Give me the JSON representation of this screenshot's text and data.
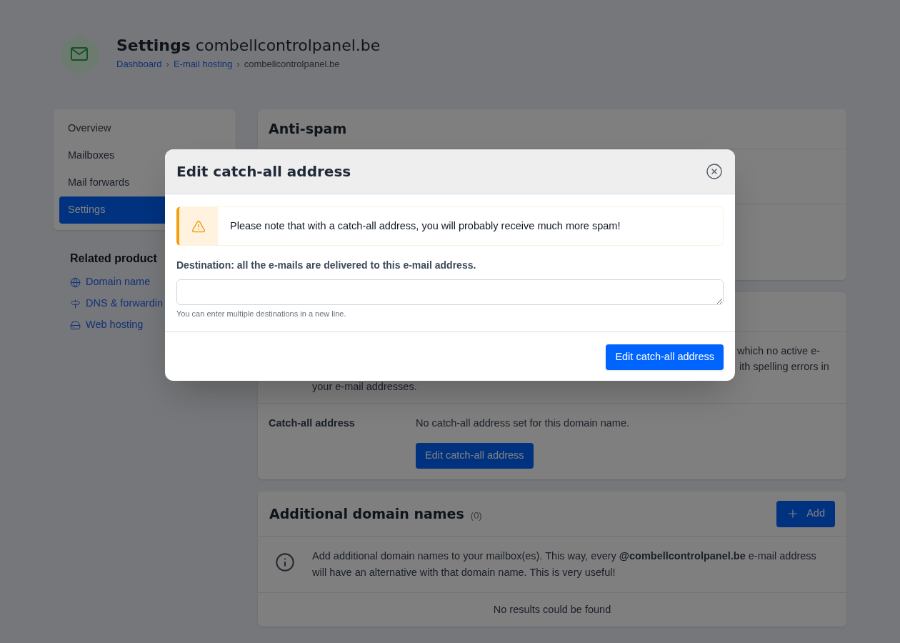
{
  "header": {
    "title": "**Settings** combellcontrolpanel.be",
    "breadcrumb": [
      {
        "kind": "link",
        "text": "Dashboard"
      },
      {
        "kind": "separator",
        "text": "›"
      },
      {
        "kind": "link",
        "text": "E-mail hosting"
      },
      {
        "kind": "separator",
        "text": "›"
      },
      {
        "kind": "current",
        "text": "combellcontrolpanel.be"
      }
    ]
  },
  "sidebar": {
    "nav": [
      {
        "label": "Overview",
        "selected": false
      },
      {
        "label": "Mailboxes",
        "selected": false
      },
      {
        "label": "Mail forwards",
        "selected": false
      },
      {
        "label": "Settings",
        "selected": true
      }
    ],
    "related": {
      "title": "Related product",
      "links": [
        "Domain name",
        "DNS & forwardin",
        "Web hosting"
      ]
    }
  },
  "anti_spam": {
    "title": "Anti-spam"
  },
  "catch_all": {
    "description_fragments": [
      "which no active e-",
      "ith spelling errors in",
      "your e-mail addresses."
    ],
    "label": "Catch-all address",
    "value": "No catch-all address set for this domain name.",
    "button": "Edit catch-all address"
  },
  "additional_domains": {
    "title": "Additional domain names",
    "count": "(0)",
    "add_button": "Add",
    "info": "Add additional domain names to your mailbox(es). This way, every **@combellcontrolpanel.be** e-mail address will have an alternative with that domain name. This is very useful!",
    "empty": "No results could be found"
  },
  "modal": {
    "title": "Edit catch-all address",
    "alert": "Please note that with a catch-all address, you will probably receive much more spam!",
    "field_label": "Destination: all the e-mails are delivered to this e-mail address.",
    "hint": "You can enter multiple destinations in a new line.",
    "submit": "Edit catch-all address"
  }
}
